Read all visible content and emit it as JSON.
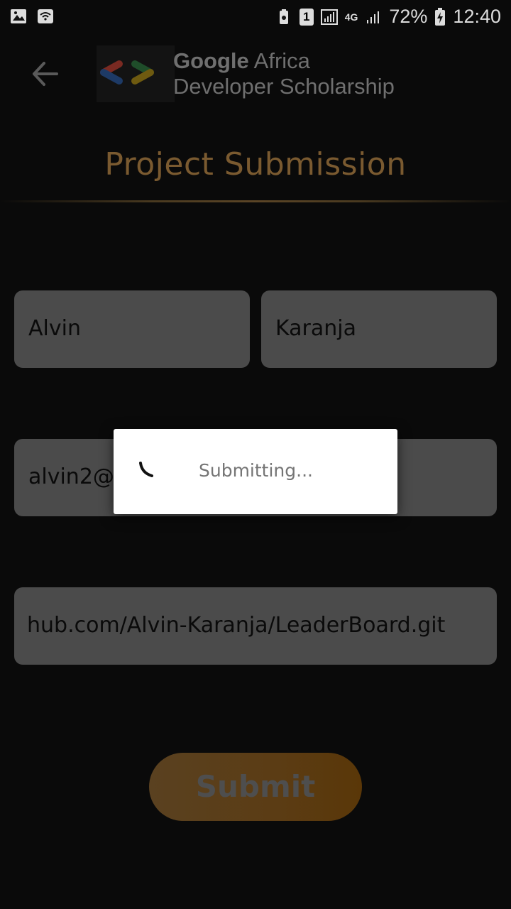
{
  "status_bar": {
    "battery": "72%",
    "time": "12:40",
    "network": "4G",
    "sim": "1"
  },
  "app_bar": {
    "logo_line1_bold": "Google",
    "logo_line1_rest": " Africa",
    "logo_line2": "Developer Scholarship"
  },
  "page": {
    "title": "Project Submission"
  },
  "form": {
    "first_name": "Alvin",
    "last_name": "Karanja",
    "email": "alvin2@",
    "github_link": "hub.com/Alvin-Karanja/LeaderBoard.git",
    "submit_label": "Submit"
  },
  "dialog": {
    "message": "Submitting..."
  },
  "colors": {
    "accent": "#7a5a30",
    "field_bg": "#4b4b4b",
    "dialog_bg": "#ffffff"
  }
}
